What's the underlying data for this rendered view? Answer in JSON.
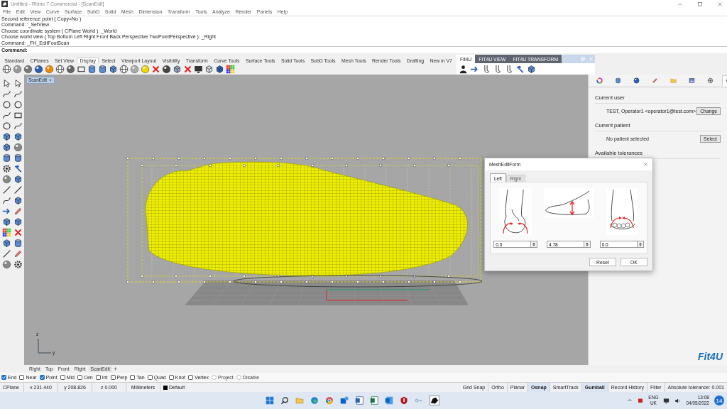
{
  "window": {
    "title": "Untitled - Rhino 7 Commercial - [ScanEdit]"
  },
  "menu": [
    "File",
    "Edit",
    "View",
    "Curve",
    "Surface",
    "SubD",
    "Solid",
    "Mesh",
    "Dimension",
    "Transform",
    "Tools",
    "Analyze",
    "Render",
    "Panels",
    "Help"
  ],
  "command_history": [
    "Second reference point ( Copy=No )",
    "Command: '_SetView",
    "Choose coordinate system ( CPlane  World ): _World",
    "Choose world view ( Top  Bottom  Left  Right  Front  Back  Perspective  TwoPointPerspective ): _Right",
    "Command: _FH_EditFootScan"
  ],
  "command_prompt": "Command:",
  "toolbar_tabs": [
    {
      "label": "Standard",
      "selected": false
    },
    {
      "label": "CPlanes",
      "selected": false
    },
    {
      "label": "Set View",
      "selected": false
    },
    {
      "label": "Display",
      "selected": true
    },
    {
      "label": "Select",
      "selected": false
    },
    {
      "label": "Viewport Layout",
      "selected": false
    },
    {
      "label": "Visibility",
      "selected": false
    },
    {
      "label": "Transform",
      "selected": false
    },
    {
      "label": "Curve Tools",
      "selected": false
    },
    {
      "label": "Surface Tools",
      "selected": false
    },
    {
      "label": "Solid Tools",
      "selected": false
    },
    {
      "label": "SubD Tools",
      "selected": false
    },
    {
      "label": "Mesh Tools",
      "selected": false
    },
    {
      "label": "Render Tools",
      "selected": false
    },
    {
      "label": "Drafting",
      "selected": false
    },
    {
      "label": "New in V7",
      "selected": false
    }
  ],
  "panel_tabs": [
    {
      "label": "Fit4U",
      "selected": true
    },
    {
      "label": "FIT4U VIEW",
      "selected": false
    },
    {
      "label": "FIT4U TRANSFORM",
      "selected": false
    }
  ],
  "viewport": {
    "title": "ScanEdit",
    "axis_labels": [
      "z",
      "y"
    ]
  },
  "viewport_tabs": [
    {
      "label": "Right",
      "selected": false
    },
    {
      "label": "Top",
      "selected": false
    },
    {
      "label": "Front",
      "selected": false
    },
    {
      "label": "Right",
      "selected": false
    },
    {
      "label": "ScanEdit",
      "selected": true
    }
  ],
  "osnaps": [
    {
      "label": "End",
      "kind": "check",
      "checked": true
    },
    {
      "label": "Near",
      "kind": "check",
      "checked": false
    },
    {
      "label": "Point",
      "kind": "check",
      "checked": true
    },
    {
      "label": "Mid",
      "kind": "check",
      "checked": false
    },
    {
      "label": "Cen",
      "kind": "check",
      "checked": false
    },
    {
      "label": "Int",
      "kind": "check",
      "checked": false
    },
    {
      "label": "Perp",
      "kind": "check",
      "checked": false
    },
    {
      "label": "Tan",
      "kind": "check",
      "checked": false
    },
    {
      "label": "Quad",
      "kind": "check",
      "checked": false
    },
    {
      "label": "Knot",
      "kind": "check",
      "checked": false
    },
    {
      "label": "Vertex",
      "kind": "check",
      "checked": false
    },
    {
      "label": "Project",
      "kind": "toggle",
      "checked": false
    },
    {
      "label": "Disable",
      "kind": "toggle",
      "checked": false
    }
  ],
  "status_bar": {
    "cplane": "CPlane",
    "x": "x 231.440",
    "y": "y 208.826",
    "z": "z 0.000",
    "units": "Millimeters",
    "layer": "Default",
    "panes": [
      {
        "label": "Grid Snap",
        "on": false
      },
      {
        "label": "Ortho",
        "on": false
      },
      {
        "label": "Planar",
        "on": false
      },
      {
        "label": "Osnap",
        "on": true
      },
      {
        "label": "SmartTrack",
        "on": false
      },
      {
        "label": "Gumball",
        "on": true
      },
      {
        "label": "Record History",
        "on": false
      },
      {
        "label": "Filter",
        "on": false
      }
    ],
    "tolerance": "Absolute tolerance: 0.001"
  },
  "right_panel": {
    "sections": [
      {
        "heading": "Current user",
        "text": "TEST, Operator1 <operator1@test.com>",
        "button": "Change"
      },
      {
        "heading": "Current patient",
        "text": "No patient selected",
        "button": "Select"
      }
    ],
    "next_heading": "Available tolerances",
    "logo": "Fit4U"
  },
  "dialog": {
    "title": "MeshEditForm",
    "tabs": [
      {
        "label": "Left",
        "selected": true
      },
      {
        "label": "Right",
        "selected": false
      }
    ],
    "fields": [
      "0.0",
      "4.78",
      "0.0"
    ],
    "buttons": [
      "Reset",
      "OK"
    ]
  },
  "taskbar": {
    "language": "ENG",
    "region": "UK",
    "time": "13:08",
    "date": "04/05/2022",
    "notifications": "14"
  }
}
